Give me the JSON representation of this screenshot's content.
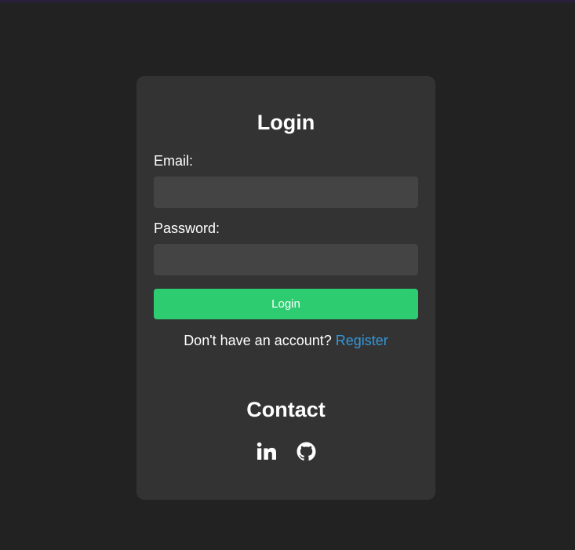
{
  "login": {
    "title": "Login",
    "email_label": "Email:",
    "email_value": "",
    "password_label": "Password:",
    "password_value": "",
    "button_label": "Login",
    "register_prompt": "Don't have an account? ",
    "register_link": "Register"
  },
  "contact": {
    "title": "Contact",
    "icons": [
      "linkedin-icon",
      "github-icon"
    ]
  },
  "colors": {
    "background": "#222222",
    "card": "#333333",
    "input": "#444444",
    "button": "#2ecc71",
    "link": "#3498db",
    "text": "#ffffff"
  }
}
